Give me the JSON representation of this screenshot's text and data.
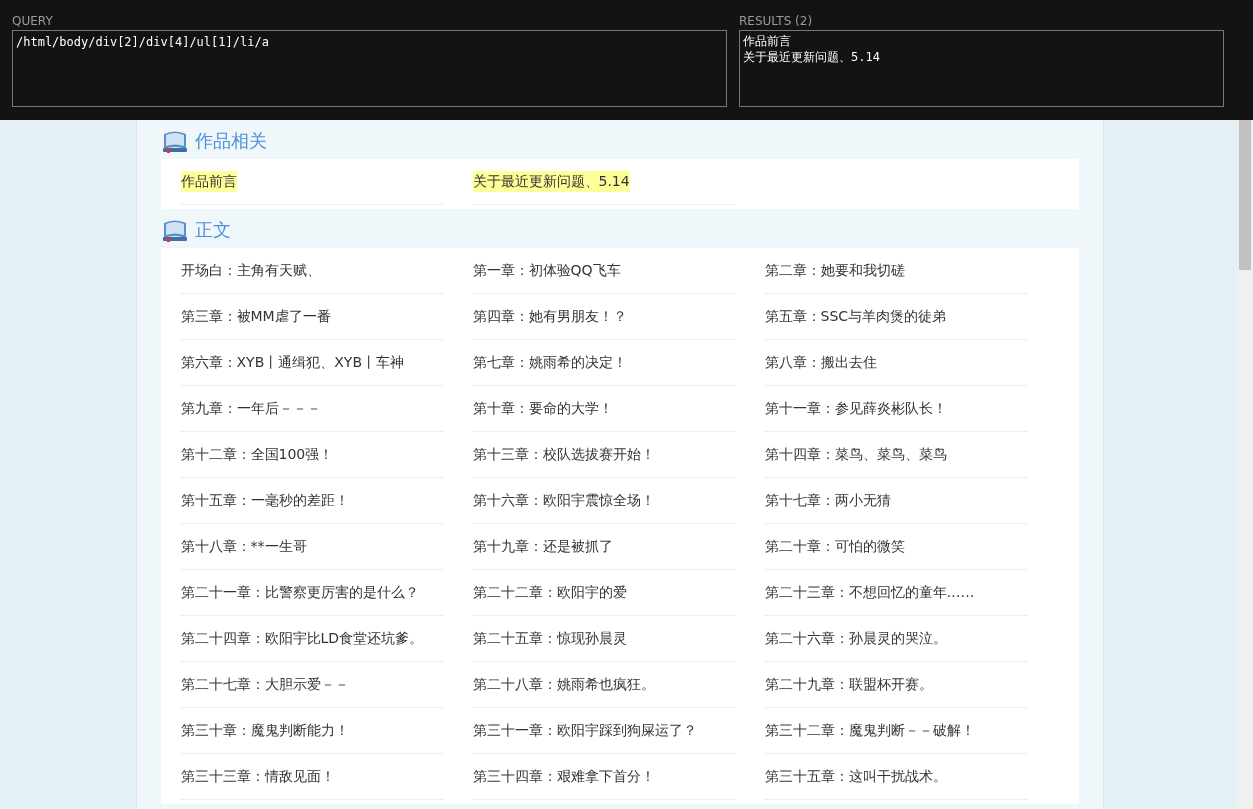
{
  "xpath_helper": {
    "query_label": "QUERY",
    "query": "/html/body/div[2]/div[4]/ul[1]/li/a",
    "results_label": "RESULTS (2)",
    "results": [
      "作品前言",
      "关于最近更新问题、5.14"
    ]
  },
  "sections": [
    {
      "title": "作品相关",
      "chapters": [
        {
          "title": "作品前言",
          "highlighted": true
        },
        {
          "title": "关于最近更新问题、5.14",
          "highlighted": true
        }
      ]
    },
    {
      "title": "正文",
      "chapters": [
        {
          "title": "开场白：主角有天赋、",
          "highlighted": false
        },
        {
          "title": "第一章：初体验QQ飞车",
          "highlighted": false
        },
        {
          "title": "第二章：她要和我切磋",
          "highlighted": false
        },
        {
          "title": "第三章：被MM虐了一番",
          "highlighted": false
        },
        {
          "title": "第四章：她有男朋友！？",
          "highlighted": false
        },
        {
          "title": "第五章：SSC与羊肉煲的徒弟",
          "highlighted": false
        },
        {
          "title": "第六章：XYB丨通缉犯、XYB丨车神",
          "highlighted": false
        },
        {
          "title": "第七章：姚雨希的决定！",
          "highlighted": false
        },
        {
          "title": "第八章：搬出去住",
          "highlighted": false
        },
        {
          "title": "第九章：一年后－－－",
          "highlighted": false
        },
        {
          "title": "第十章：要命的大学！",
          "highlighted": false
        },
        {
          "title": "第十一章：参见薛炎彬队长！",
          "highlighted": false
        },
        {
          "title": "第十二章：全国100强！",
          "highlighted": false
        },
        {
          "title": "第十三章：校队选拔赛开始！",
          "highlighted": false
        },
        {
          "title": "第十四章：菜鸟、菜鸟、菜鸟",
          "highlighted": false
        },
        {
          "title": "第十五章：一毫秒的差距！",
          "highlighted": false
        },
        {
          "title": "第十六章：欧阳宇震惊全场！",
          "highlighted": false
        },
        {
          "title": "第十七章：两小无猜",
          "highlighted": false
        },
        {
          "title": "第十八章：**一生哥",
          "highlighted": false
        },
        {
          "title": "第十九章：还是被抓了",
          "highlighted": false
        },
        {
          "title": "第二十章：可怕的微笑",
          "highlighted": false
        },
        {
          "title": "第二十一章：比警察更厉害的是什么？",
          "highlighted": false
        },
        {
          "title": "第二十二章：欧阳宇的爱",
          "highlighted": false
        },
        {
          "title": "第二十三章：不想回忆的童年……",
          "highlighted": false
        },
        {
          "title": "第二十四章：欧阳宇比LD食堂还坑爹。",
          "highlighted": false
        },
        {
          "title": "第二十五章：惊现孙晨灵",
          "highlighted": false
        },
        {
          "title": "第二十六章：孙晨灵的哭泣。",
          "highlighted": false
        },
        {
          "title": "第二十七章：大胆示爱－－",
          "highlighted": false
        },
        {
          "title": "第二十八章：姚雨希也疯狂。",
          "highlighted": false
        },
        {
          "title": "第二十九章：联盟杯开赛。",
          "highlighted": false
        },
        {
          "title": "第三十章：魔鬼判断能力！",
          "highlighted": false
        },
        {
          "title": "第三十一章：欧阳宇踩到狗屎运了？",
          "highlighted": false
        },
        {
          "title": "第三十二章：魔鬼判断－－破解！",
          "highlighted": false
        },
        {
          "title": "第三十三章：情敌见面！",
          "highlighted": false
        },
        {
          "title": "第三十四章：艰难拿下首分！",
          "highlighted": false
        },
        {
          "title": "第三十五章：这叫干扰战术。",
          "highlighted": false
        }
      ]
    }
  ]
}
